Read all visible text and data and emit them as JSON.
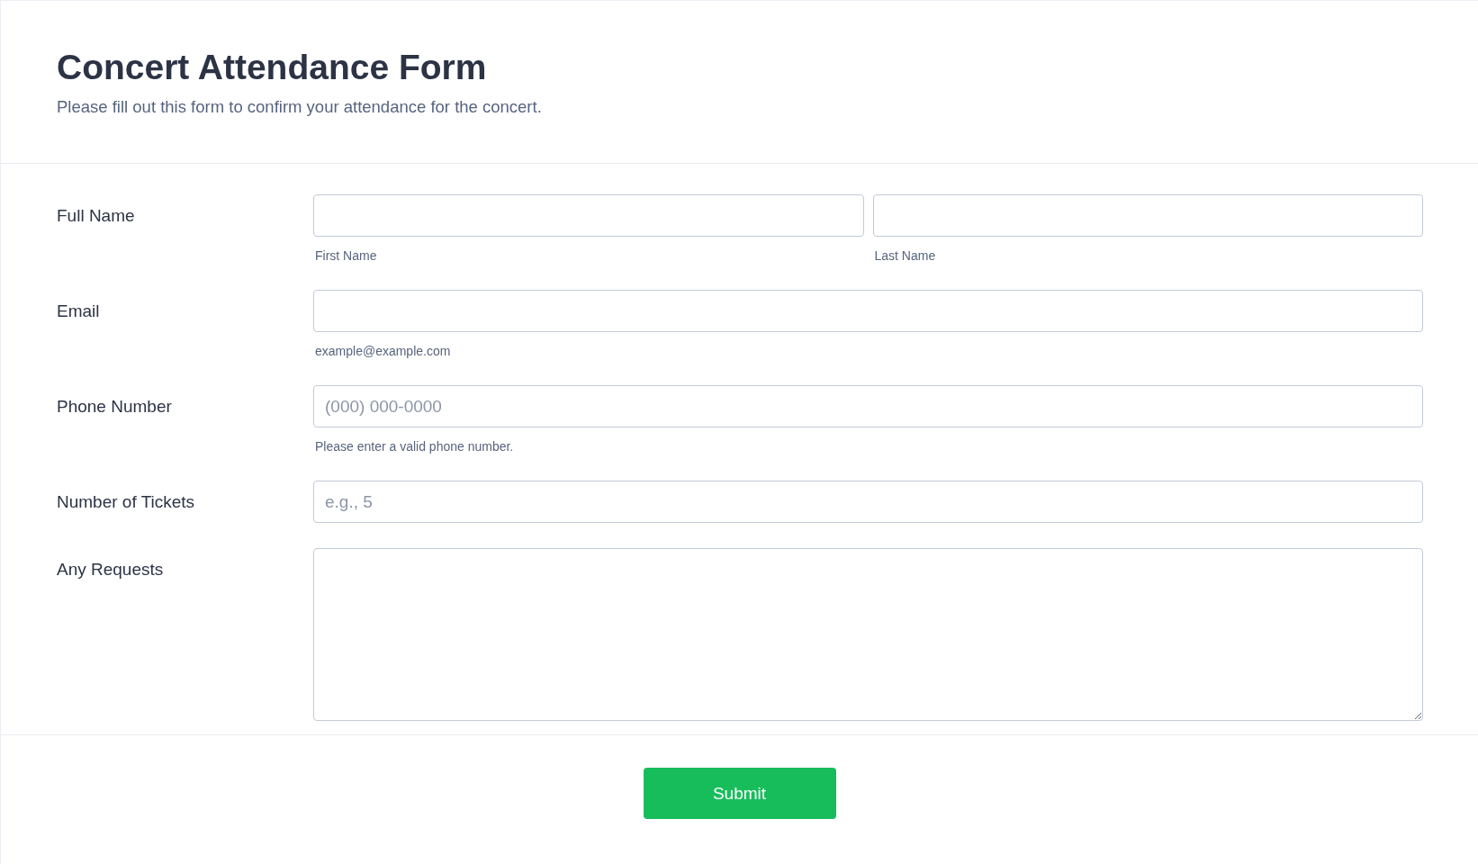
{
  "header": {
    "title": "Concert Attendance Form",
    "subtitle": "Please fill out this form to confirm your attendance for the concert."
  },
  "fields": [
    {
      "kind": "split",
      "label": "Full Name",
      "parts": [
        {
          "sublabel": "First Name"
        },
        {
          "sublabel": "Last Name"
        }
      ]
    },
    {
      "kind": "text",
      "label": "Email",
      "sublabel": "example@example.com"
    },
    {
      "kind": "text",
      "label": "Phone Number",
      "placeholder": "(000) 000-0000",
      "sublabel": "Please enter a valid phone number."
    },
    {
      "kind": "text",
      "label": "Number of Tickets",
      "placeholder": "e.g., 5"
    },
    {
      "kind": "textarea",
      "label": "Any Requests"
    }
  ],
  "submit": {
    "label": "Submit"
  }
}
